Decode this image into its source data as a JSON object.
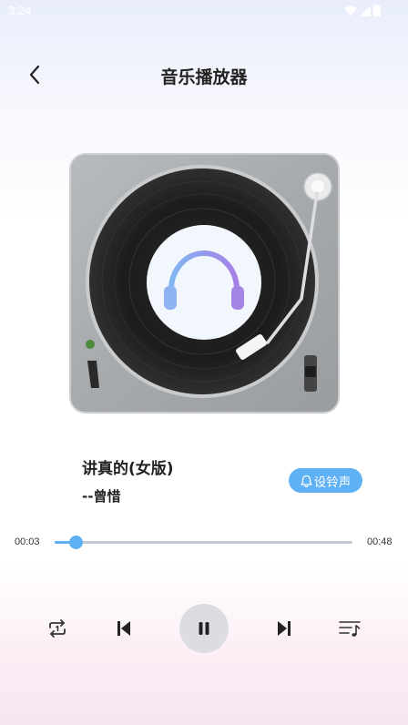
{
  "status_bar": {
    "time": "3:24"
  },
  "header": {
    "title": "音乐播放器"
  },
  "song": {
    "title": "讲真的(女版)",
    "artist": "--曾惜"
  },
  "ringtone_button": {
    "label": "设铃声"
  },
  "progress": {
    "current_time": "00:03",
    "total_time": "00:48",
    "fraction": 0.07
  },
  "colors": {
    "accent": "#5fb1f6",
    "pause_bg": "#dcdde2"
  },
  "icons": {
    "back": "chevron-left-icon",
    "repeat": "repeat-icon",
    "previous": "skip-previous-icon",
    "pause": "pause-icon",
    "next": "skip-next-icon",
    "playlist": "playlist-icon",
    "bell": "bell-icon",
    "headphones": "headphones-icon"
  }
}
